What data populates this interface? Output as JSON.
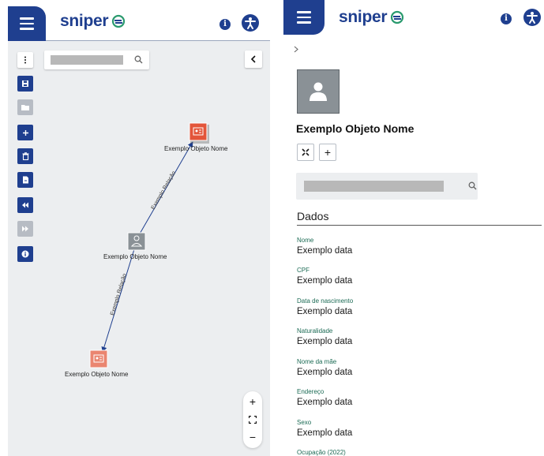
{
  "brand": {
    "name": "sniper",
    "color": "#1f3f8f",
    "accent": "#2a9a6e"
  },
  "left_panel": {
    "search": {
      "placeholder": ""
    },
    "toolbar": [
      {
        "icon": "kebab-icon",
        "style": "light"
      },
      {
        "icon": "save-icon",
        "style": "primary"
      },
      {
        "icon": "folder-icon",
        "style": "disabled"
      },
      {
        "icon": "plus-icon",
        "style": "primary"
      },
      {
        "icon": "trash-icon",
        "style": "primary"
      },
      {
        "icon": "file-icon",
        "style": "primary"
      },
      {
        "icon": "rewind-icon",
        "style": "primary"
      },
      {
        "icon": "fast-forward-icon",
        "style": "disabled"
      },
      {
        "icon": "info-icon",
        "style": "primary"
      }
    ],
    "graph": {
      "nodes": [
        {
          "id": "n1",
          "label": "Exemplo Objeto Nome",
          "type": "document",
          "color": "#e3553a"
        },
        {
          "id": "n2",
          "label": "Exemplo Objeto Nome",
          "type": "person",
          "color": "#8a9196"
        },
        {
          "id": "n3",
          "label": "Exemplo Objeto Nome",
          "type": "document",
          "color": "#ea8570"
        }
      ],
      "edges": [
        {
          "from": "n2",
          "to": "n1",
          "label": "Exemplo Relação"
        },
        {
          "from": "n2",
          "to": "n3",
          "label": "Exemplo Relação"
        }
      ]
    },
    "zoom": {
      "in": "+",
      "fit": "⛶",
      "out": "−"
    }
  },
  "right_panel": {
    "breadcrumb_chevron": "›",
    "object_title": "Exemplo Objeto Nome",
    "actions": [
      {
        "icon": "collapse-icon"
      },
      {
        "icon": "plus-icon",
        "label": "+"
      }
    ],
    "search": {
      "placeholder": ""
    },
    "section_title": "Dados",
    "fields": [
      {
        "label": "Nome",
        "value": "Exemplo data"
      },
      {
        "label": "CPF",
        "value": "Exemplo data"
      },
      {
        "label": "Data de nascimento",
        "value": "Exemplo data"
      },
      {
        "label": "Naturalidade",
        "value": "Exemplo data"
      },
      {
        "label": "Nome da mãe",
        "value": "Exemplo data"
      },
      {
        "label": "Endereço",
        "value": "Exemplo data"
      },
      {
        "label": "Sexo",
        "value": "Exemplo data"
      },
      {
        "label": "Ocupação (2022)",
        "value": ""
      }
    ]
  }
}
